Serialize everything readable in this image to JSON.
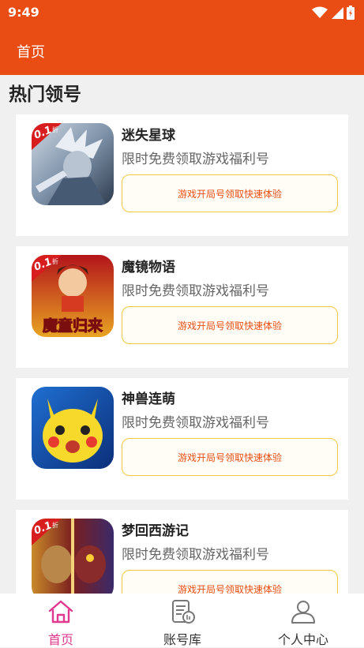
{
  "status_bar": {
    "time": "9:49",
    "icons": [
      "wifi-icon",
      "signal-icon",
      "battery-icon"
    ]
  },
  "app_bar": {
    "title": "首页"
  },
  "section": {
    "title": "热门领号"
  },
  "games": [
    {
      "name": "迷失星球",
      "desc": "限时免费领取游戏福利号",
      "cta": "游戏开局号领取快速体验",
      "badge": "0.1",
      "badge_unit": "折"
    },
    {
      "name": "魔镜物语",
      "desc": "限时免费领取游戏福利号",
      "cta": "游戏开局号领取快速体验",
      "badge": "0.1",
      "badge_unit": "折",
      "art_text": "魔童归来"
    },
    {
      "name": "神兽连萌",
      "desc": "限时免费领取游戏福利号",
      "cta": "游戏开局号领取快速体验"
    },
    {
      "name": "梦回西游记",
      "desc": "限时免费领取游戏福利号",
      "cta": "游戏开局号领取快速体验",
      "badge": "0.1",
      "badge_unit": "折"
    }
  ],
  "tabs": [
    {
      "label": "首页",
      "icon": "home-icon",
      "active": true
    },
    {
      "label": "账号库",
      "icon": "account-library-icon",
      "active": false
    },
    {
      "label": "个人中心",
      "icon": "person-icon",
      "active": false
    }
  ],
  "colors": {
    "primary": "#e94d14",
    "active_tab": "#e0398f",
    "cta_border": "#f5c842"
  }
}
